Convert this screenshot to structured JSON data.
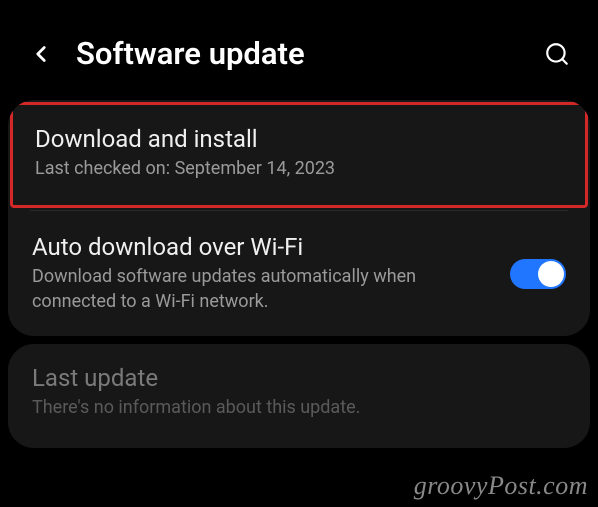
{
  "header": {
    "title": "Software update"
  },
  "card1": {
    "download": {
      "title": "Download and install",
      "subtitle": "Last checked on: September 14, 2023"
    },
    "auto": {
      "title": "Auto download over Wi-Fi",
      "subtitle": "Download software updates automatically when connected to a Wi-Fi network."
    }
  },
  "card2": {
    "last": {
      "title": "Last update",
      "subtitle": "There's no information about this update."
    }
  },
  "watermark": "groovyPost.com"
}
